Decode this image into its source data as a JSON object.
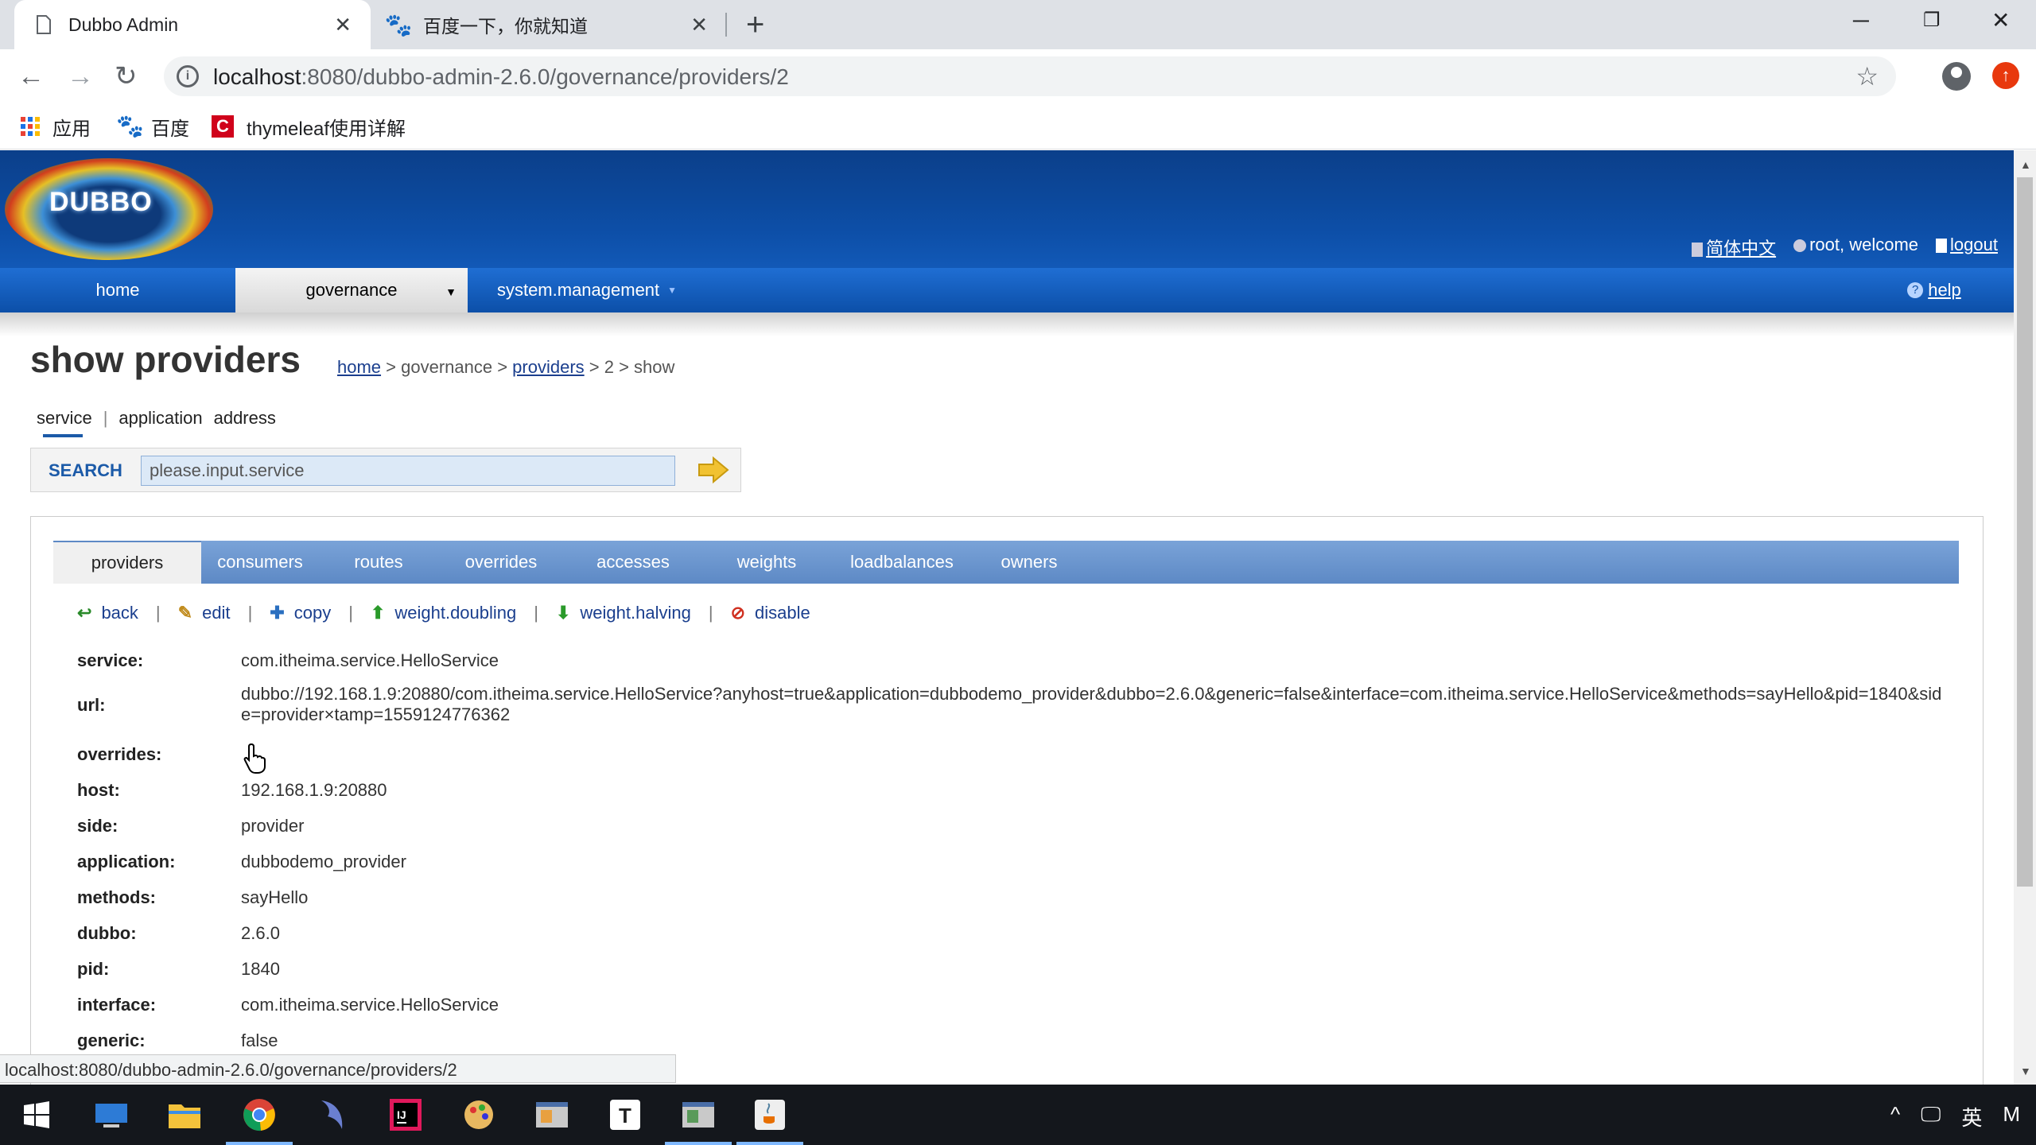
{
  "browser": {
    "tabs": [
      {
        "title": "Dubbo Admin",
        "active": true
      },
      {
        "title": "百度一下，你就知道",
        "active": false
      }
    ],
    "url_host": "localhost",
    "url_path": ":8080/dubbo-admin-2.6.0/governance/providers/2",
    "bookmarks": [
      {
        "label": "应用",
        "icon": "apps-grid-icon"
      },
      {
        "label": "百度",
        "icon": "baidu-paw-icon"
      },
      {
        "label": "thymeleaf使用详解",
        "icon": "thymeleaf-c-icon"
      }
    ],
    "status_url": "localhost:8080/dubbo-admin-2.6.0/governance/providers/2"
  },
  "header": {
    "logo_text": "DUBBO",
    "lang_link": "简体中文",
    "welcome": "root, welcome",
    "logout": "logout"
  },
  "menu": {
    "home": "home",
    "governance": "governance",
    "system": "system.management",
    "help": "help"
  },
  "page": {
    "title": "show providers",
    "breadcrumb": {
      "home": "home",
      "sep1": " > governance > ",
      "providers": "providers",
      "tail": " > 2 > show"
    }
  },
  "search": {
    "tabs": [
      "service",
      "application",
      "address"
    ],
    "label": "SEARCH",
    "placeholder": "please.input.service"
  },
  "content_tabs": [
    "providers",
    "consumers",
    "routes",
    "overrides",
    "accesses",
    "weights",
    "loadbalances",
    "owners"
  ],
  "actions": [
    {
      "label": "back",
      "icon": "back-arrow-icon",
      "color": "#2a8a2a"
    },
    {
      "label": "edit",
      "icon": "pencil-icon",
      "color": "#c08a1a"
    },
    {
      "label": "copy",
      "icon": "plus-icon",
      "color": "#2a6fc0"
    },
    {
      "label": "weight.doubling",
      "icon": "up-arrow-icon",
      "color": "#2a9a2a"
    },
    {
      "label": "weight.halving",
      "icon": "down-arrow-icon",
      "color": "#2a9a2a"
    },
    {
      "label": "disable",
      "icon": "ban-icon",
      "color": "#d03020"
    }
  ],
  "fields": [
    {
      "label": "service:",
      "value": "com.itheima.service.HelloService"
    },
    {
      "label": "url:",
      "value": "dubbo://192.168.1.9:20880/com.itheima.service.HelloService?anyhost=true&application=dubbodemo_provider&dubbo=2.6.0&generic=false&interface=com.itheima.service.HelloService&methods=sayHello&pid=1840&side=provider×tamp=1559124776362"
    },
    {
      "label": "overrides:",
      "value": ""
    },
    {
      "label": "host:",
      "value": "192.168.1.9:20880"
    },
    {
      "label": "side:",
      "value": "provider"
    },
    {
      "label": "application:",
      "value": "dubbodemo_provider"
    },
    {
      "label": "methods:",
      "value": "sayHello"
    },
    {
      "label": "dubbo:",
      "value": "2.6.0"
    },
    {
      "label": "pid:",
      "value": "1840"
    },
    {
      "label": "interface:",
      "value": "com.itheima.service.HelloService"
    },
    {
      "label": "generic:",
      "value": "false"
    }
  ],
  "taskbar": {
    "tray": [
      "^",
      "英",
      "M"
    ]
  }
}
